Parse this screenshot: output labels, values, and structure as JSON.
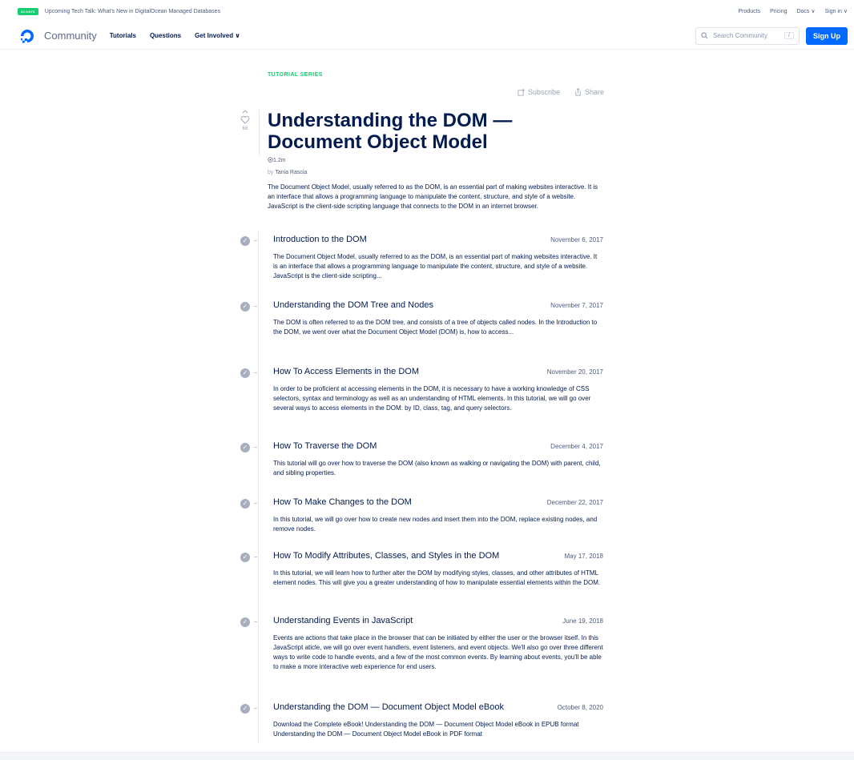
{
  "announcement": {
    "badge": "23 DAYS",
    "text": "Upcoming Tech Talk: What's New in DigitalOcean Managed Databases",
    "links": [
      "Products",
      "Pricing",
      "Docs ∨",
      "Sign in ∨"
    ]
  },
  "nav": {
    "brand": "Community",
    "links": [
      "Tutorials",
      "Questions",
      "Get Involved ∨"
    ],
    "search_placeholder": "Search Community",
    "search_shortcut": "/",
    "signup_label": "Sign Up"
  },
  "series": {
    "label": "TUTORIAL SERIES",
    "subscribe_label": "Subscribe",
    "share_label": "Share",
    "like_count": "68",
    "title": "Understanding the DOM — Document Object Model",
    "views": "1.2m",
    "by": "by",
    "author": "Tania Rascia",
    "intro": "The Document Object Model, usually referred to as the DOM, is an essential part of making websites interactive. It is an interface that allows a programming language to manipulate the content, structure, and style of a website. JavaScript is the client-side scripting language that connects to the DOM in an internet browser."
  },
  "tutorials": [
    {
      "title": "Introduction to the DOM",
      "date": "November 6, 2017",
      "desc": "The Document Object Model, usually referred to as the DOM, is an essential part of making websites interactive. It is an interface that allows a programming language to manipulate the content, structure, and style of a website. JavaScript is the client-side scripting..."
    },
    {
      "title": "Understanding the DOM Tree and Nodes",
      "date": "November 7, 2017",
      "desc": "The DOM is often referred to as the DOM tree, and consists of a tree of objects called nodes. In the Introduction to the DOM, we went over what the Document Object Model (DOM) is, how to access..."
    },
    {
      "title": "How To Access Elements in the DOM",
      "date": "November 20, 2017",
      "desc": "In order to be proficient at accessing elements in the DOM, it is necessary to have a working knowledge of CSS selectors, syntax and terminology as well as an understanding of HTML elements. In this tutorial, we will go over several ways to access elements in the DOM: by ID, class, tag, and query selectors."
    },
    {
      "title": "How To Traverse the DOM",
      "date": "December 4, 2017",
      "desc": "This tutorial will go over how to traverse the DOM (also known as walking or navigating the DOM) with parent, child, and sibling properties."
    },
    {
      "title": "How To Make Changes to the DOM",
      "date": "December 22, 2017",
      "desc": "In this tutorial, we will go over how to create new nodes and insert them into the DOM, replace existing nodes, and remove nodes."
    },
    {
      "title": "How To Modify Attributes, Classes, and Styles in the DOM",
      "date": "May 17, 2018",
      "desc": "In this tutorial, we will learn how to further alter the DOM by modifying styles, classes, and other attributes of HTML element nodes. This will give you a greater understanding of how to manipulate essential elements within the DOM."
    },
    {
      "title": "Understanding Events in JavaScript",
      "date": "June 19, 2018",
      "desc": "Events are actions that take place in the browser that can be initiated by either the user or the browser itself. In this JavaScript aticle, we will go over event handlers, event listeners, and event objects. We'll also go over three different ways to write code to handle events, and a few of the most common events. By learning about events, you'll be able to make a more interactive web experience for end users."
    },
    {
      "title": "Understanding the DOM — Document Object Model eBook",
      "date": "October 8, 2020",
      "desc": "Download the Complete eBook! Understanding the DOM — Document Object Model eBook in EPUB format Understanding the DOM — Document Object Model eBook in PDF format"
    }
  ],
  "colors": {
    "accent": "#0069ff",
    "green": "#15cd72",
    "text": "#031b4e"
  }
}
